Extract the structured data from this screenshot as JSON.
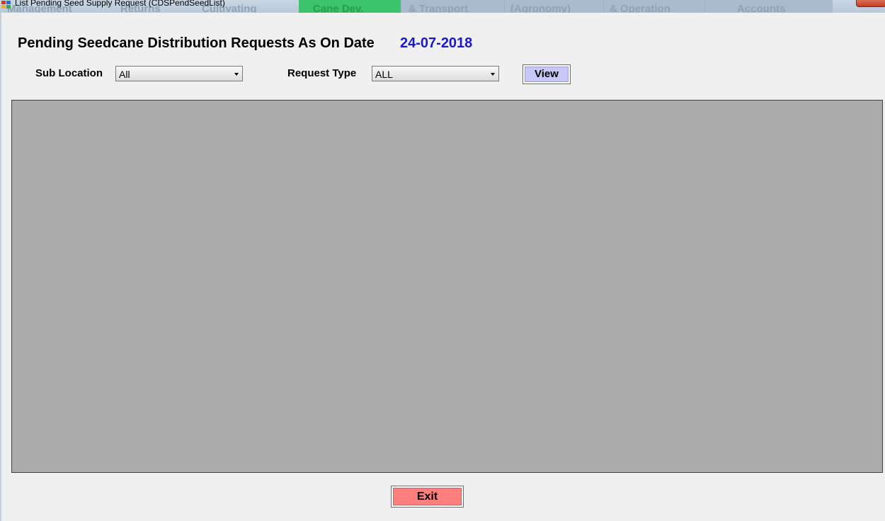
{
  "window": {
    "title": "List Pending  Seed Supply Request (CDSPendSeedList)",
    "background_tabs": [
      "Management",
      "Returns",
      "Cultivating",
      "Cane Dev.",
      "& Transport",
      "(Agronomy)",
      "& Operation",
      "Accounts"
    ]
  },
  "header": {
    "title": "Pending Seedcane Distribution Requests As On Date",
    "date": "24-07-2018"
  },
  "filters": {
    "sub_location_label": "Sub Location",
    "sub_location_value": "All",
    "request_type_label": "Request Type",
    "request_type_value": "ALL"
  },
  "actions": {
    "view_label": "View",
    "exit_label": "Exit"
  },
  "colors": {
    "date_color": "#1a1acc",
    "view_button": "#c8c8f6",
    "exit_button": "#ff7f7f",
    "grid_background": "#ababab"
  }
}
